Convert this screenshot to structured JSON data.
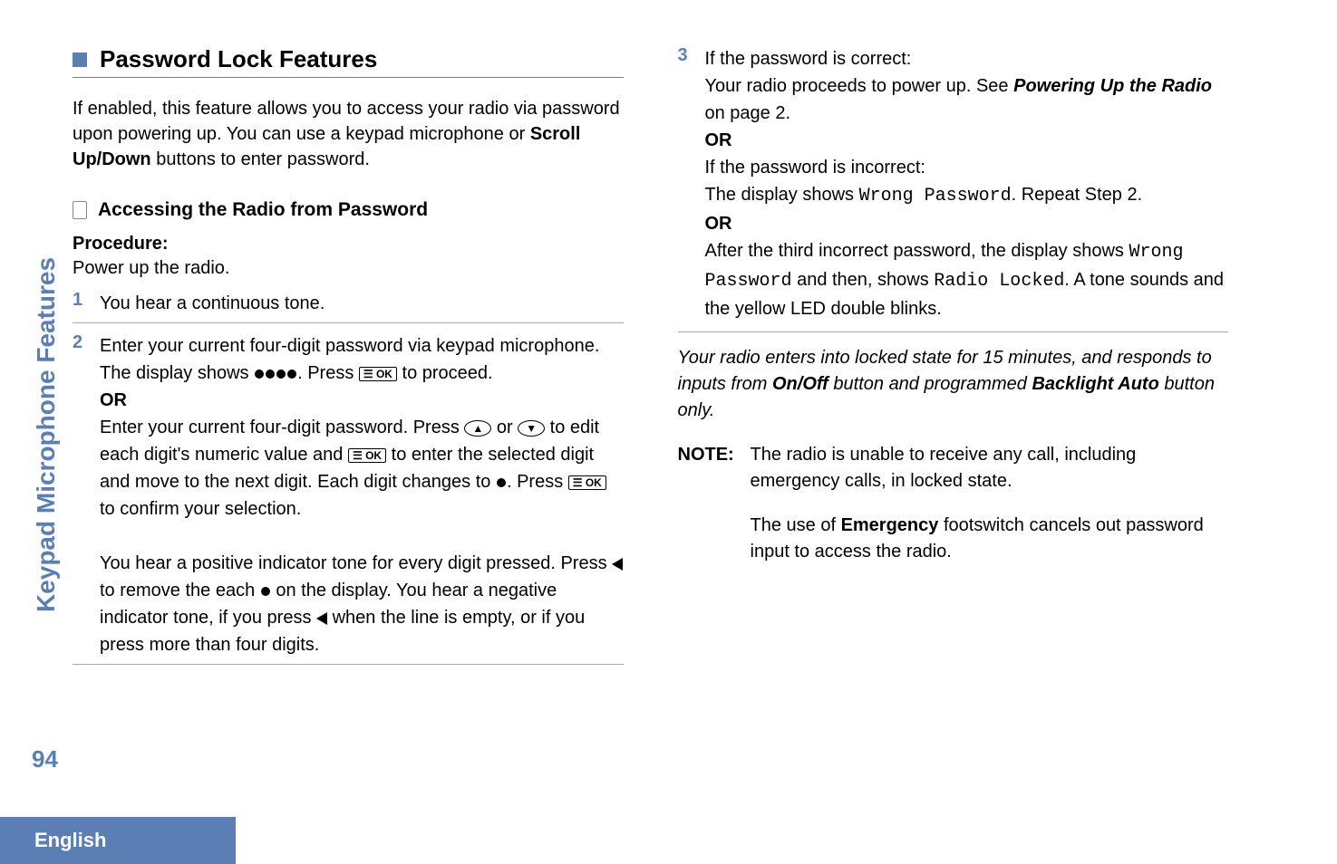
{
  "sidebar": {
    "label": "Keypad Microphone Features"
  },
  "section": {
    "title": "Password Lock Features",
    "intro_part1": "If enabled, this feature allows you to access your radio via password upon powering up. You can use a keypad microphone or ",
    "intro_bold": "Scroll Up/Down",
    "intro_part2": " buttons to enter password."
  },
  "subsection": {
    "title": "Accessing the Radio from Password",
    "procedure_label": "Procedure:",
    "procedure_intro": "Power up the radio."
  },
  "steps": {
    "s1": "You hear a continuous tone.",
    "s2_line1": "Enter your current four-digit password via keypad microphone.",
    "s2_line2a": "The display shows ",
    "s2_line2b": ". Press ",
    "s2_line2c": " to proceed.",
    "s2_or": "OR",
    "s2_line3a": "Enter your current four-digit password. Press ",
    "s2_line3b": " or ",
    "s2_line3c": " to edit each digit's numeric value and ",
    "s2_line3d": " to enter the selected digit and move to the next digit. Each digit changes to ",
    "s2_line3e": ". Press ",
    "s2_line3f": " to confirm your selection.",
    "s2_line4a": "You hear a positive indicator tone for every digit pressed. Press ",
    "s2_line4b": " to remove the each ",
    "s2_line4c": " on the display. You hear a negative indicator tone, if you press ",
    "s2_line4d": " when the line is empty, or if you press more than four digits.",
    "s3_line1": "If the password is correct:",
    "s3_line2a": "Your radio proceeds to power up. See ",
    "s3_line2_bold": "Powering Up the Radio",
    "s3_line2b": " on page 2.",
    "s3_or1": "OR",
    "s3_line3": "If the password is incorrect:",
    "s3_line4a": "The display shows ",
    "s3_mono1": "Wrong Password",
    "s3_line4b": ". Repeat Step 2.",
    "s3_or2": "OR",
    "s3_line5a": "After the third incorrect password, the display shows ",
    "s3_mono2": "Wrong Password",
    "s3_line5b": " and then, shows ",
    "s3_mono3": "Radio Locked",
    "s3_line5c": ". A tone sounds and the yellow LED double blinks."
  },
  "note_italic": {
    "part1": "Your radio enters into locked state for 15 minutes, and responds to inputs from ",
    "bold1": "On/Off",
    "part2": " button and programmed ",
    "bold2": "Backlight  Auto",
    "part3": " button only."
  },
  "note_block": {
    "label": "NOTE:",
    "p1": "The radio is unable to receive any call, including emergency calls, in locked state.",
    "p2a": "The use of ",
    "p2_bold": "Emergency",
    "p2b": " footswitch cancels out password input to access the radio."
  },
  "page_number": "94",
  "footer": {
    "language": "English"
  },
  "icons": {
    "ok": "☰ OK",
    "up": "▲",
    "down": "▼"
  }
}
